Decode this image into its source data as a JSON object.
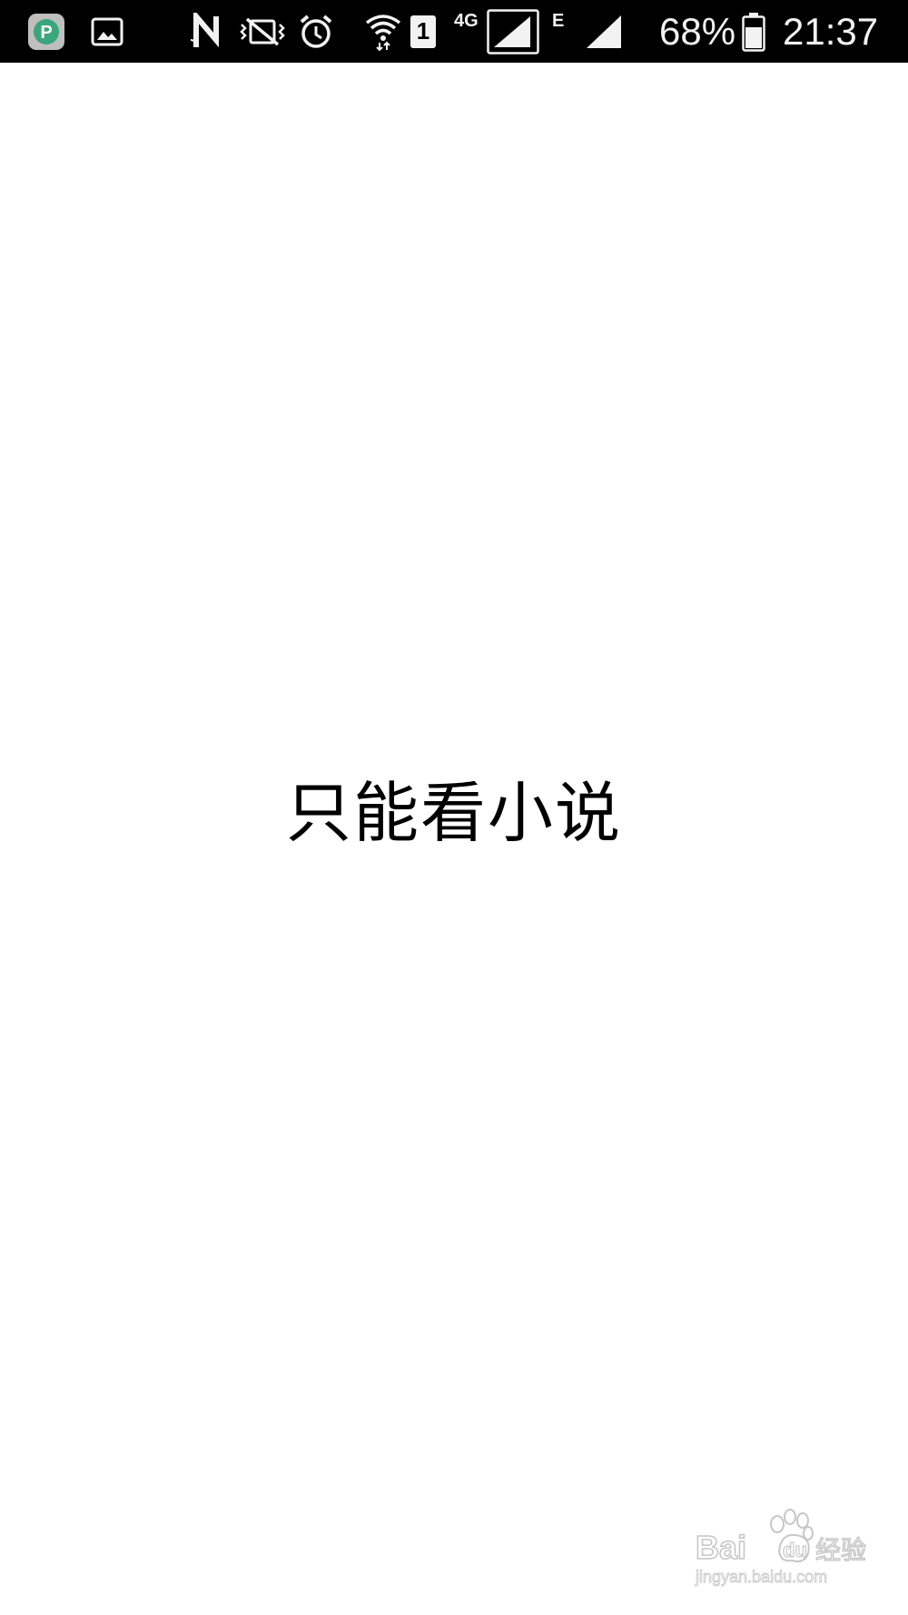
{
  "status_bar": {
    "icons": [
      "app-p-icon",
      "gallery-icon",
      "nfc-icon",
      "vibrate-mute-icon",
      "alarm-icon",
      "wifi-icon",
      "sim1-icon",
      "signal-4g-icon",
      "signal-e-icon"
    ],
    "network_4g": "4G",
    "network_e": "E",
    "sim_slot": "1",
    "app_icon_letter": "P",
    "battery_percent": "68%",
    "time": "21:37",
    "colors": {
      "background": "#000000",
      "foreground": "#f2f2f2",
      "app_icon": "#3aa67a"
    }
  },
  "main": {
    "message": "只能看小说"
  },
  "watermark": {
    "brand_latin_1": "Bai",
    "brand_latin_2": "du",
    "brand_cn": "经验",
    "url": "jingyan.baidu.com"
  }
}
